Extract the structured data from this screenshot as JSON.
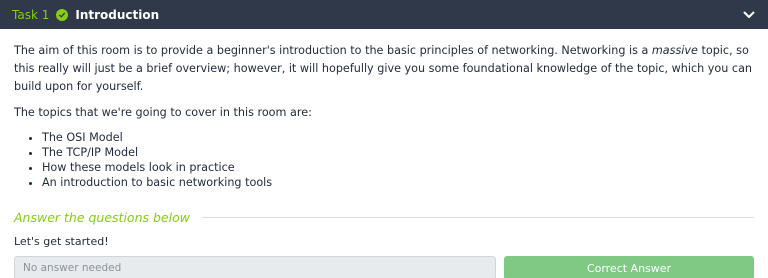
{
  "header": {
    "task_label": "Task 1",
    "title": "Introduction",
    "check_icon": "check-circle-icon",
    "chevron_icon": "chevron-down-icon",
    "accent_color": "#88cc14",
    "background_color": "#2f394a"
  },
  "content": {
    "paragraph1_before": "The aim of this room is to provide a beginner's introduction to the basic principles of networking. Networking is a ",
    "paragraph1_em": "massive",
    "paragraph1_after": " topic, so this really will just be a brief overview; however, it will hopefully give you some foundational knowledge of the topic, which you can build upon for yourself.",
    "paragraph2": "The topics that we're going to cover in this room are:",
    "topics": [
      "The OSI Model",
      "The TCP/IP Model",
      "How these models look in practice",
      "An introduction to basic networking tools"
    ]
  },
  "answers": {
    "section_title": "Answer the questions below",
    "question": "Let's get started!",
    "input_placeholder": "No answer needed",
    "button_label": "Correct Answer",
    "button_color": "#7fc985"
  }
}
